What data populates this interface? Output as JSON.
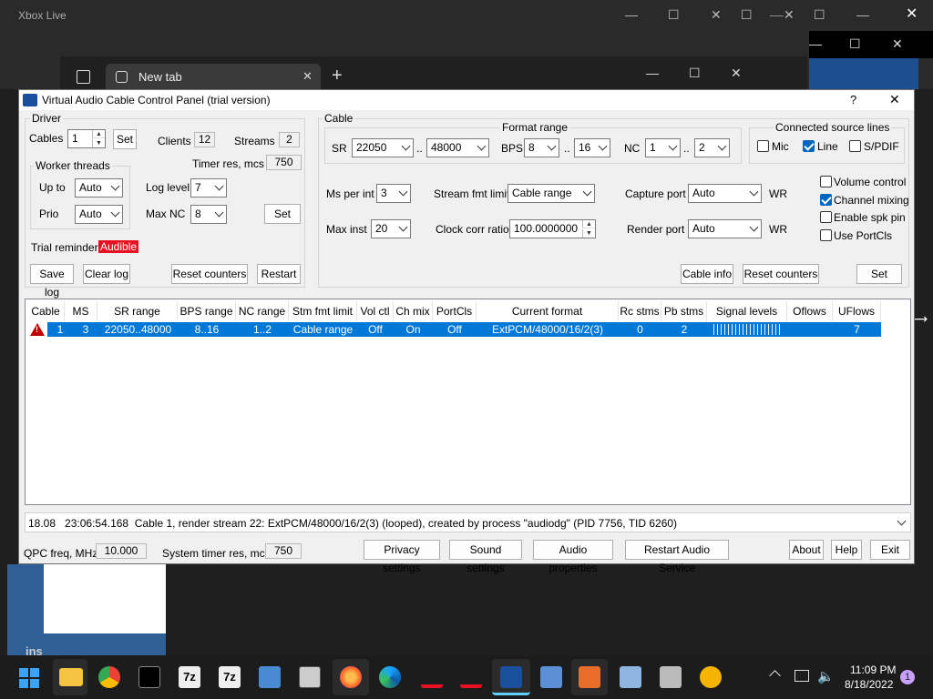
{
  "background": {
    "xbox_title": "Xbox Live",
    "browser_tab": "New tab",
    "desktop_label": "ins"
  },
  "window": {
    "title": "Virtual Audio Cable Control Panel (trial version)",
    "help_glyph": "?",
    "close_glyph": "✕"
  },
  "driver": {
    "group_label": "Driver",
    "cables_label": "Cables",
    "cables_value": "1",
    "set_label": "Set",
    "clients_label": "Clients",
    "clients_value": "12",
    "streams_label": "Streams",
    "streams_value": "2",
    "timer_label": "Timer res, mcs",
    "timer_value": "750",
    "worker_label": "Worker threads",
    "upto_label": "Up to",
    "upto_value": "Auto",
    "prio_label": "Prio",
    "prio_value": "Auto",
    "loglevel_label": "Log level",
    "loglevel_value": "7",
    "maxnc_label": "Max NC",
    "maxnc_value": "8",
    "set2_label": "Set",
    "trial_label": "Trial reminder",
    "trial_value": "Audible",
    "save_log": "Save log",
    "clear_log": "Clear log",
    "reset_counters": "Reset counters",
    "restart": "Restart"
  },
  "cable": {
    "group_label": "Cable",
    "format_range_label": "Format range",
    "sr_label": "SR",
    "sr_from": "22050",
    "sr_to": "48000",
    "dots": "..",
    "bps_label": "BPS",
    "bps_from": "8",
    "bps_to": "16",
    "nc_label": "NC",
    "nc_from": "1",
    "nc_to": "2",
    "connected_label": "Connected source lines",
    "mic_label": "Mic",
    "line_label": "Line",
    "spdif_label": "S/PDIF",
    "ms_label": "Ms per int",
    "ms_value": "3",
    "stream_limit_label": "Stream fmt limit",
    "stream_limit_value": "Cable range",
    "capture_label": "Capture port",
    "capture_value": "Auto",
    "wr1": "WR",
    "maxinst_label": "Max inst",
    "maxinst_value": "20",
    "clock_label": "Clock corr ratio",
    "clock_value": "100.0000000",
    "render_label": "Render port",
    "render_value": "Auto",
    "wr2": "WR",
    "volume_label": "Volume control",
    "channel_label": "Channel mixing",
    "spkpin_label": "Enable spk pin",
    "portcls_label": "Use PortCls",
    "cable_info": "Cable info",
    "reset_counters": "Reset counters",
    "set_label": "Set"
  },
  "table": {
    "headers": [
      "Cable",
      "MS",
      "SR range",
      "BPS range",
      "NC range",
      "Stm fmt limit",
      "Vol ctl",
      "Ch mix",
      "PortCls",
      "Current format",
      "Rc stms",
      "Pb stms",
      "Signal levels",
      "Oflows",
      "UFlows"
    ],
    "row": [
      "1",
      "3",
      "22050..48000",
      "8..16",
      "1..2",
      "Cable range",
      "Off",
      "On",
      "Off",
      "ExtPCM/48000/16/2(3)",
      "0",
      "2",
      "",
      "",
      "7"
    ]
  },
  "log": {
    "text": "18.08   23:06:54.168  Cable 1, render stream 22: ExtPCM/48000/16/2(3) (looped), created by process \"audiodg\" (PID 7756, TID 6260)"
  },
  "footer": {
    "qpc_label": "QPC freq, MHz",
    "qpc_value": "10.000",
    "systimer_label": "System timer res, mcs",
    "systimer_value": "750",
    "privacy": "Privacy settings",
    "sound": "Sound settings",
    "audio_props": "Audio properties",
    "restart_audio": "Restart Audio Service",
    "about": "About",
    "help": "Help",
    "exit": "Exit"
  },
  "taskbar": {
    "time": "11:09 PM",
    "date": "8/18/2022",
    "notif_count": "1",
    "sevenzip1": "7z",
    "sevenzip2": "7z"
  }
}
